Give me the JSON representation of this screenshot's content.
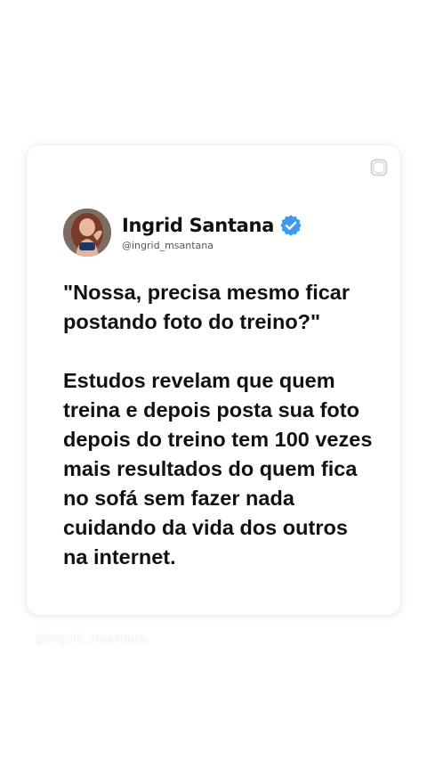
{
  "profile": {
    "display_name": "Ingrid Santana",
    "handle": "@ingrid_msantana",
    "verified": true
  },
  "post": {
    "quote": "\"Nossa, precisa mesmo ficar postando foto do treino?\"",
    "body": "Estudos revelam que quem treina e depois posta sua foto depois do treino tem 100 vezes mais resultados do quem fica no sofá sem fazer nada cuidando da vida dos outros na internet."
  },
  "watermark": "@ingrid_msantana",
  "icons": {
    "corner": "instagram-icon",
    "verified": "verified-badge-icon"
  },
  "colors": {
    "background": "#ffffff",
    "card": "#ffffff",
    "text": "#111111",
    "handle": "#555555",
    "verified_blue": "#3a9bf0"
  }
}
